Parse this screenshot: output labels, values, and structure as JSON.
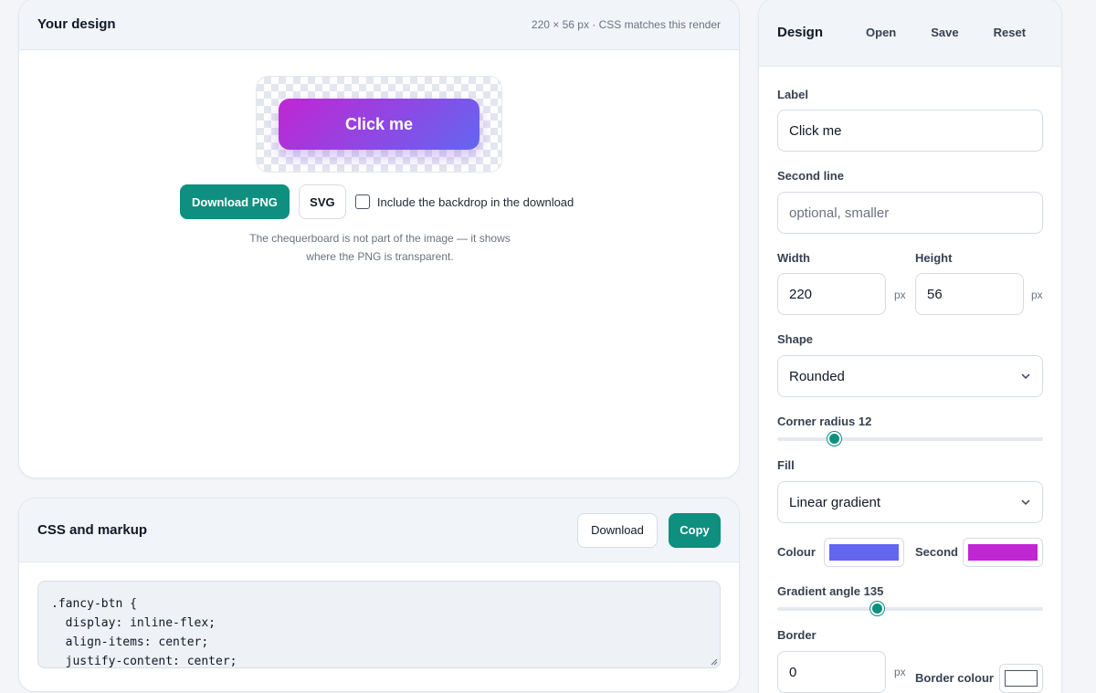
{
  "design": {
    "title": "Your design",
    "meta": "220 × 56 px · CSS matches this render",
    "button_label": "Click me",
    "download_png": "Download PNG",
    "svg": "SVG",
    "include_backdrop": "Include the backdrop in the download",
    "hint_line1": "The chequerboard is not part of the image — it shows",
    "hint_line2": "where the PNG is transparent."
  },
  "css_card": {
    "title": "CSS and markup",
    "download": "Download",
    "copy": "Copy",
    "code": ".fancy-btn {\n  display: inline-flex;\n  align-items: center;\n  justify-content: center;"
  },
  "panel": {
    "title": "Design",
    "open": "Open",
    "save": "Save",
    "reset": "Reset",
    "label_label": "Label",
    "label_value": "Click me",
    "second_line_label": "Second line",
    "second_line_placeholder": "optional, smaller",
    "width_label": "Width",
    "width_value": "220",
    "height_label": "Height",
    "height_value": "56",
    "unit_px": "px",
    "shape_label": "Shape",
    "shape_value": "Rounded",
    "corner_radius_label": "Corner radius 12",
    "corner_radius_value": 12,
    "corner_radius_max": 56,
    "fill_label": "Fill",
    "fill_value": "Linear gradient",
    "colour_label": "Colour",
    "colour_value": "#6366f1",
    "second_label": "Second",
    "second_value": "#c026d3",
    "gradient_angle_label": "Gradient angle 135",
    "gradient_angle_value": 135,
    "gradient_angle_max": 360,
    "border_label": "Border",
    "border_value": "0",
    "border_colour_label": "Border colour",
    "border_colour_value": "#ffffff"
  },
  "colors": {
    "accent": "#0f8f7f",
    "gradient_start": "#c026d3",
    "gradient_end": "#6366f1"
  }
}
